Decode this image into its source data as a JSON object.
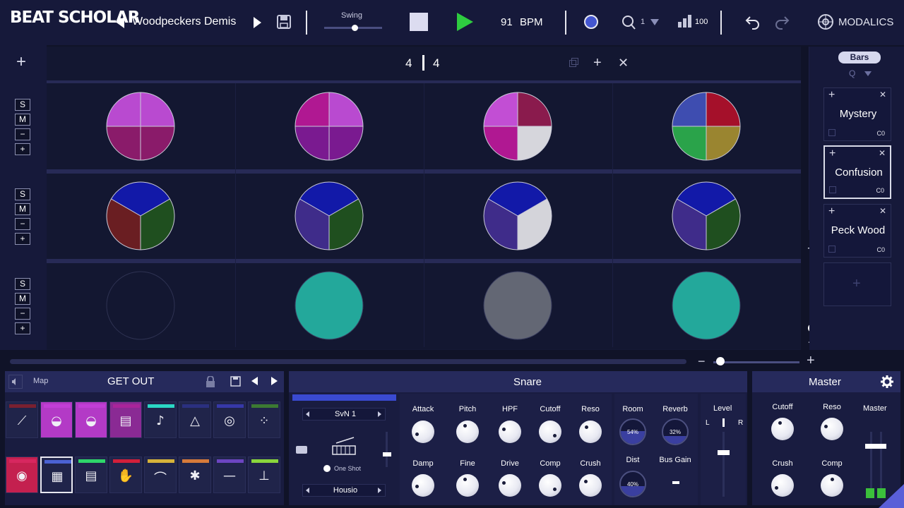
{
  "app": {
    "logo_text": "BEAT SCHOLAR",
    "brand": "MODALICS"
  },
  "topbar": {
    "song_name": "Woodpeckers Demis",
    "swing_label": "Swing",
    "swing_value": 0.5,
    "tempo_value": "91",
    "tempo_unit": "BPM",
    "metronome_count": "1",
    "volume_value": "100",
    "colors": {
      "play": "#2ecc40",
      "record": "#4456d0",
      "accent": "#8a8fd8"
    }
  },
  "grid": {
    "time_sig_top": "4",
    "time_sig_bottom": "4",
    "rows": [
      {
        "solo": "S",
        "mute": "M",
        "minus": "−",
        "plus": "+"
      },
      {
        "solo": "S",
        "mute": "M",
        "minus": "−",
        "plus": "+"
      },
      {
        "solo": "S",
        "mute": "M",
        "minus": "−",
        "plus": "+"
      }
    ],
    "row1_slices": [
      [
        "#b94ad0",
        "#b94ad0",
        "#8a1b6a",
        "#8a1b6a"
      ],
      [
        "#b01892",
        "#b94ad0",
        "#7a1a90",
        "#7a1a90"
      ],
      [
        "#c24ed4",
        "#8a1b4d",
        "#b01892",
        "#d6d6dc"
      ],
      [
        "#3e4db0",
        "#a5102a",
        "#2aa34a",
        "#9a8530"
      ]
    ],
    "row2_slices": [
      [
        "#1219a8",
        "#1f4f1f",
        "#6a1e22"
      ],
      [
        "#1219a8",
        "#1f4f1f",
        "#3f2c8a"
      ],
      [
        "#1219a8",
        "#d4d4da",
        "#3f2c8a"
      ],
      [
        "#1219a8",
        "#1f4f1f",
        "#3f2c8a"
      ]
    ],
    "row3_fills": [
      "none",
      "#23a89b",
      "#636774",
      "#23a89b"
    ]
  },
  "patterns": {
    "header": "Bars",
    "quantize": "Q",
    "items": [
      {
        "name": "Mystery",
        "code": "C0"
      },
      {
        "name": "Confusion",
        "code": "C0"
      },
      {
        "name": "Peck Wood",
        "code": "C0"
      }
    ]
  },
  "kit": {
    "map_label": "Map",
    "kit_name": "GET OUT",
    "pad_colors_top": [
      "#7a2030",
      "#c23ed6",
      "#c23ed6",
      "#a9249a",
      "#2bd6c4",
      "#2b3080",
      "#3638a8",
      "#3c7a33"
    ],
    "pad_colors_bottom": [
      "#d7275f",
      "#4b62d4",
      "#2ed66a",
      "#d21f3a",
      "#d6b23a",
      "#d67a3a",
      "#6c45c0",
      "#8ad63c"
    ],
    "pad_icons": [
      "hat-icon",
      "drum-icon",
      "drum-icon",
      "drum-icon",
      "maracas-icon",
      "triangle-icon",
      "spiral-icon",
      "dots-icon",
      "speaker-icon",
      "snare-icon",
      "snare-icon",
      "clap-icon",
      "cymbal-icon",
      "crash-icon",
      "ride-icon",
      "splash-icon"
    ]
  },
  "snare": {
    "title": "Snare",
    "sample_name": "SvN 1",
    "one_shot_label": "One Shot",
    "preset_name": "Housio",
    "knobs_top": [
      "Attack",
      "Pitch",
      "HPF",
      "Cutoff",
      "Reso",
      "Room",
      "Reverb"
    ],
    "knobs_bottom": [
      "Damp",
      "Fine",
      "Drive",
      "Comp",
      "Crush",
      "Dist",
      "Bus Gain"
    ],
    "room_value": "54%",
    "reverb_value": "32%",
    "dist_value": "40%",
    "level_label": "Level",
    "left_label": "L",
    "right_label": "R"
  },
  "master": {
    "title": "Master",
    "knobs": [
      "Cutoff",
      "Reso",
      "Crush",
      "Comp"
    ],
    "fader_label": "Master"
  }
}
